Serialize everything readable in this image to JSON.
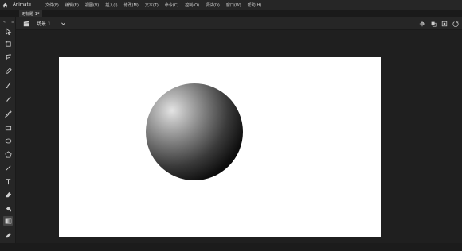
{
  "app": {
    "name": "Animate",
    "menu": [
      "文件(F)",
      "编辑(E)",
      "视图(V)",
      "插入(I)",
      "修改(M)",
      "文本(T)",
      "命令(C)",
      "控制(O)",
      "调试(D)",
      "窗口(W)",
      "帮助(H)"
    ]
  },
  "document": {
    "tab_label": "无标题-1*"
  },
  "scene": {
    "label": "场景 1"
  },
  "toolbar": {
    "collapse_glyph": "«",
    "grip_glyph": "≡"
  },
  "colors": {
    "chrome": "#262626",
    "workspace": "#1f1f1f",
    "stage": "#ffffff",
    "sphere_highlight": "#e4e4e4",
    "sphere_shadow": "#000000"
  }
}
